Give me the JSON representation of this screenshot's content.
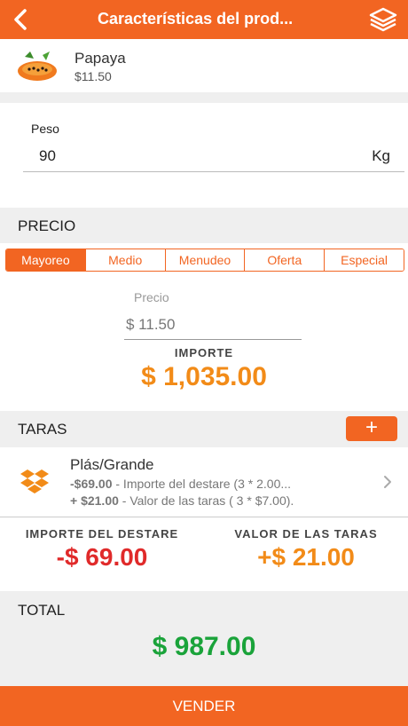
{
  "header": {
    "title": "Características del prod...",
    "back_icon": "chevron-left-icon",
    "layers_icon": "layers-icon"
  },
  "product": {
    "name": "Papaya",
    "price": "$11.50"
  },
  "peso": {
    "label": "Peso",
    "value": "90",
    "unit": "Kg"
  },
  "precio": {
    "section_title": "PRECIO",
    "tabs": [
      "Mayoreo",
      "Medio",
      "Menudeo",
      "Oferta",
      "Especial"
    ],
    "active_tab": "Mayoreo",
    "field_label": "Precio",
    "field_value": "$ 11.50",
    "importe_label": "IMPORTE",
    "importe_value": "$ 1,035.00"
  },
  "taras": {
    "section_title": "TARAS",
    "add_label": "+",
    "items": [
      {
        "name": "Plás/Grande",
        "line1_amount": "-$69.00",
        "line1_text": " - Importe del destare (3 * 2.00...",
        "line2_amount": "+ $21.00",
        "line2_text": " - Valor de las taras ( 3 * $7.00)."
      }
    ]
  },
  "summary": {
    "destare_label": "IMPORTE DEL DESTARE",
    "destare_value": "-$ 69.00",
    "taras_label": "VALOR DE LAS TARAS",
    "taras_value": "+$ 21.00"
  },
  "total": {
    "label": "TOTAL",
    "value": "$ 987.00"
  },
  "footer": {
    "vender_label": "VENDER"
  },
  "colors": {
    "accent": "#f26522",
    "importe": "#f28b18",
    "negative": "#e02a2a",
    "positive": "#f28b18",
    "total": "#1aa33a"
  }
}
